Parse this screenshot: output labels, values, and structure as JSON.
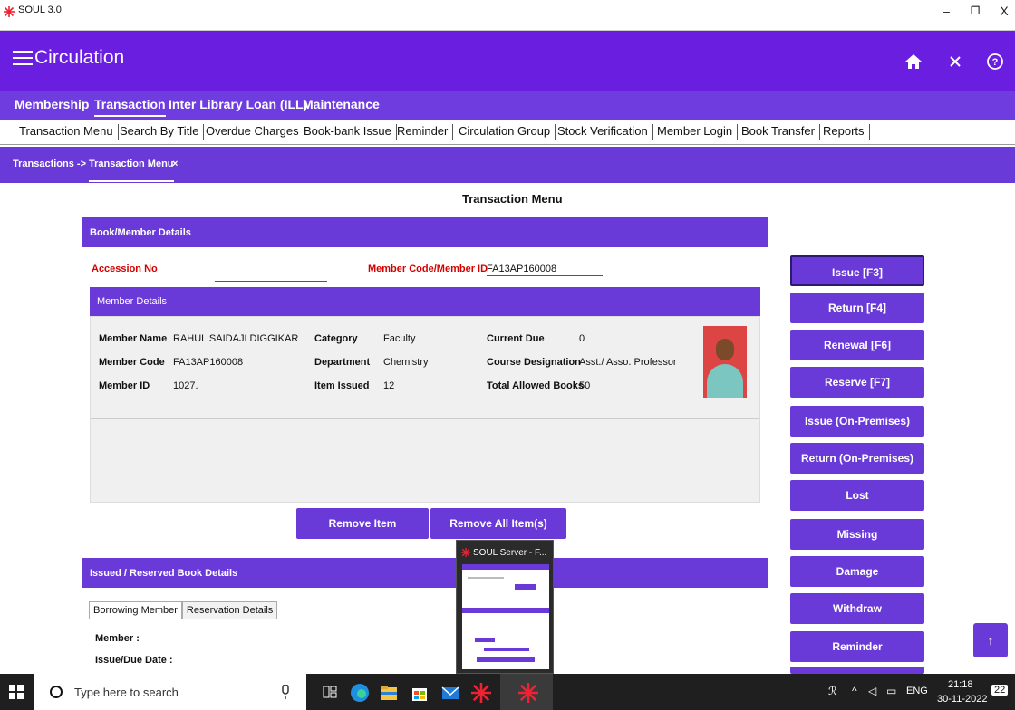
{
  "window": {
    "title": "SOUL 3.0",
    "minimize": "–",
    "restore": "❐",
    "close": "X"
  },
  "appbar": {
    "title": "Circulation",
    "home_icon": "⌂",
    "close_icon": "×",
    "help_icon": "?"
  },
  "main_nav": [
    "Membership",
    "Transaction",
    "Inter Library Loan (ILL)",
    "Maintenance"
  ],
  "sub_nav": [
    "Transaction Menu",
    "Search By Title",
    "Overdue Charges",
    "Book-bank Issue",
    "Reminder",
    "Circulation Group",
    "Stock Verification",
    "Member Login",
    "Book Transfer",
    "Reports"
  ],
  "breadcrumb": {
    "root": "Transactions ->",
    "tab": "Transaction Menu",
    "close": "×"
  },
  "page_title": "Transaction Menu",
  "book_member": {
    "header": "Book/Member Details",
    "accession_label": "Accession No",
    "accession_value": "",
    "member_code_label": "Member Code/Member ID",
    "member_code_value": "FA13AP160008",
    "member_details_header": "Member Details",
    "fields": {
      "member_name_label": "Member Name",
      "member_name": "RAHUL SAIDAJI DIGGIKAR",
      "member_code_label": "Member Code",
      "member_code": "FA13AP160008",
      "member_id_label": "Member ID",
      "member_id": "1027.",
      "category_label": "Category",
      "category": "Faculty",
      "department_label": "Department",
      "department": "Chemistry",
      "item_issued_label": "Item Issued",
      "item_issued": "12",
      "current_due_label": "Current Due",
      "current_due": "0",
      "course_designation_label": "Course Designation",
      "course_designation": "Asst./ Asso. Professor",
      "total_allowed_label": "Total Allowed Books",
      "total_allowed": "50"
    },
    "remove_item": "Remove Item",
    "remove_all": "Remove All Item(s)"
  },
  "issued_panel": {
    "header": "Issued / Reserved Book Details",
    "tabs": [
      "Borrowing Member",
      "Reservation Details"
    ],
    "member_label": "Member :",
    "issue_due_label": "Issue/Due Date :"
  },
  "side_buttons": [
    "Issue [F3]",
    "Return [F4]",
    "Renewal [F6]",
    "Reserve [F7]",
    "Issue (On-Premises)",
    "Return (On-Premises)",
    "Lost",
    "Missing",
    "Damage",
    "Withdraw",
    "Reminder"
  ],
  "preview": {
    "title": "SOUL Server - F..."
  },
  "taskbar": {
    "search_placeholder": "Type here to search",
    "time": "21:18",
    "date": "30-11-2022",
    "lang": "ENG",
    "notif": "22"
  },
  "colors": {
    "accent": "#6a3ad8",
    "appbar": "#6a1fe0",
    "required": "#d40000"
  }
}
